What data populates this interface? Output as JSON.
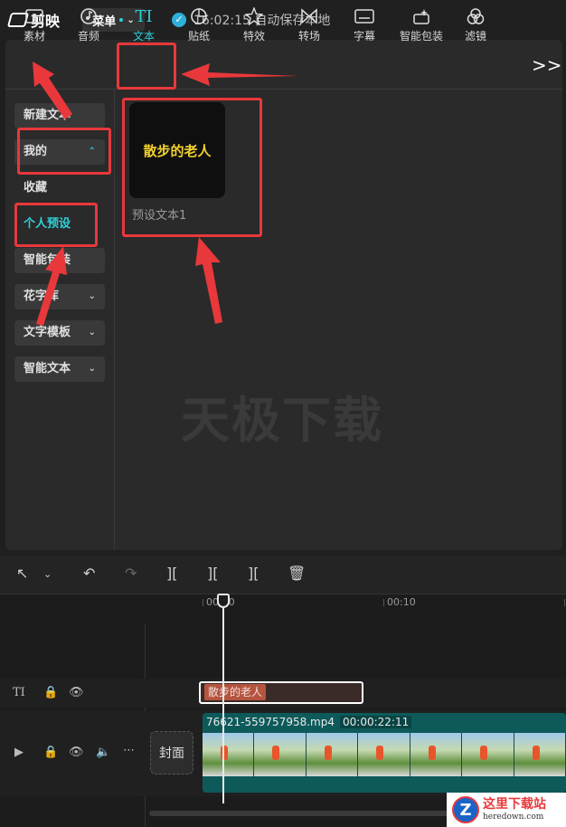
{
  "app": {
    "name": "剪映",
    "menu_label": "菜单",
    "save_status": "16:02:15 自动保存本地"
  },
  "toolbar": {
    "tabs": [
      {
        "label": "素材",
        "icon": "media-icon"
      },
      {
        "label": "音频",
        "icon": "audio-icon"
      },
      {
        "label": "文本",
        "icon": "text-icon",
        "active": true
      },
      {
        "label": "贴纸",
        "icon": "sticker-icon"
      },
      {
        "label": "特效",
        "icon": "effects-icon"
      },
      {
        "label": "转场",
        "icon": "transition-icon"
      },
      {
        "label": "字幕",
        "icon": "subtitle-icon"
      },
      {
        "label": "智能包装",
        "icon": "smart-pack-icon"
      },
      {
        "label": "滤镜",
        "icon": "filter-icon"
      }
    ],
    "more_label": ">>"
  },
  "sidebar": {
    "items": [
      {
        "label": "新建文本"
      },
      {
        "label": "我的",
        "expanded": true
      },
      {
        "label": "收藏"
      },
      {
        "label": "个人预设",
        "selected": true
      },
      {
        "label": "智能包装"
      },
      {
        "label": "花字库"
      },
      {
        "label": "文字模板"
      },
      {
        "label": "智能文本"
      }
    ]
  },
  "preset": {
    "thumb_text": "散步的老人",
    "label": "预设文本1"
  },
  "watermark": "天极下载",
  "timeline": {
    "ruler": [
      "00:00",
      "00:10"
    ],
    "text_clip": "散步的老人",
    "video_clip": {
      "name": "76621-559757958.mp4",
      "duration": "00:00:22:11"
    },
    "cover_label": "封面"
  },
  "site_logo": {
    "title": "这里下载站",
    "domain": "heredown.com"
  },
  "colors": {
    "accent": "#2fd0d8",
    "annotation": "#e8383b",
    "background": "#1f1f1f"
  }
}
